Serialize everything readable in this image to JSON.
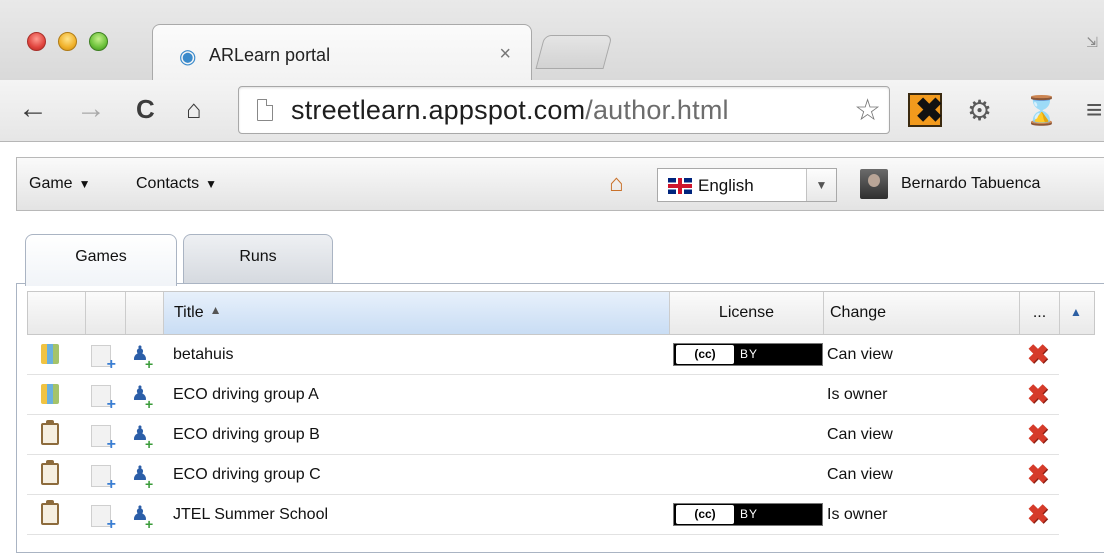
{
  "browser": {
    "tab_title": "ARLearn portal",
    "tab_close": "×",
    "url_host": "streetlearn.appspot.com",
    "url_path": "/author.html"
  },
  "app": {
    "menus": [
      {
        "label": "Game"
      },
      {
        "label": "Contacts"
      }
    ],
    "language": "English",
    "user_name": "Bernardo Tabuenca"
  },
  "tabs": [
    {
      "label": "Games",
      "active": true
    },
    {
      "label": "Runs",
      "active": false
    }
  ],
  "grid": {
    "columns": {
      "title": "Title",
      "license": "License",
      "change": "Change",
      "more": "..."
    },
    "sort": {
      "column": "title",
      "direction": "ascending"
    },
    "rows": [
      {
        "icon": "map-icon",
        "title": "betahuis",
        "license": "CC BY",
        "change": "Can view"
      },
      {
        "icon": "map-icon",
        "title": "ECO driving group A",
        "license": "",
        "change": "Is owner"
      },
      {
        "icon": "clipboard-icon",
        "title": "ECO driving group B",
        "license": "",
        "change": "Can view"
      },
      {
        "icon": "clipboard-icon",
        "title": "ECO driving group C",
        "license": "",
        "change": "Can view"
      },
      {
        "icon": "clipboard-icon",
        "title": "JTEL Summer School",
        "license": "CC BY",
        "change": "Is owner"
      }
    ],
    "license_badge_cc": "(cc)",
    "license_badge_by": "BY"
  },
  "colors": {
    "sorted_header": "#c9ddf4",
    "delete": "#d63b2a",
    "tab_border": "#aab4c3"
  }
}
